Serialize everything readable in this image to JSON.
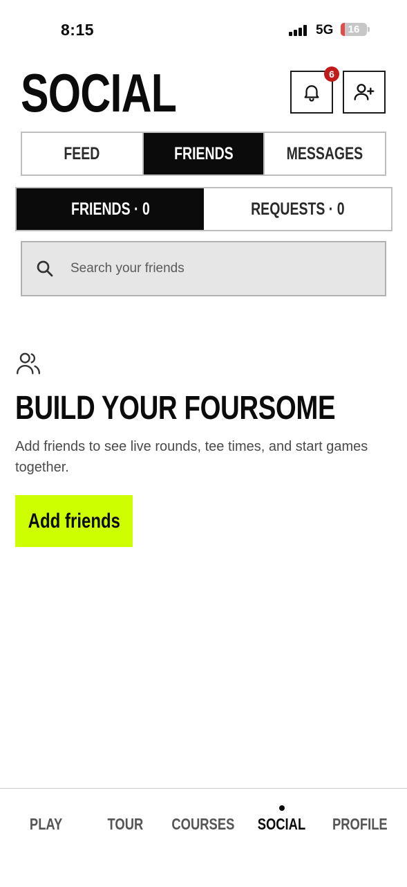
{
  "status_bar": {
    "time": "8:15",
    "network": "5G",
    "battery": "16",
    "battery_color": "#e54a4a"
  },
  "header": {
    "title": "SOCIAL",
    "notifications_badge": "6"
  },
  "tabs": [
    {
      "label": "FEED",
      "active": false
    },
    {
      "label": "FRIENDS",
      "active": true
    },
    {
      "label": "MESSAGES",
      "active": false
    }
  ],
  "segments": [
    {
      "label": "FRIENDS · 0",
      "active": true
    },
    {
      "label": "REQUESTS · 0",
      "active": false
    }
  ],
  "search": {
    "placeholder": "Search your friends"
  },
  "empty_state": {
    "icon": "people-icon",
    "title": "BUILD YOUR FOURSOME",
    "text": "Add friends to see live rounds, tee times, and start games together.",
    "cta_label": "Add friends",
    "cta_color": "#cdff00"
  },
  "bottom_nav": [
    {
      "label": "PLAY",
      "active": false
    },
    {
      "label": "TOUR",
      "active": false
    },
    {
      "label": "COURSES",
      "active": false
    },
    {
      "label": "SOCIAL",
      "active": true
    },
    {
      "label": "PROFILE",
      "active": false
    }
  ]
}
